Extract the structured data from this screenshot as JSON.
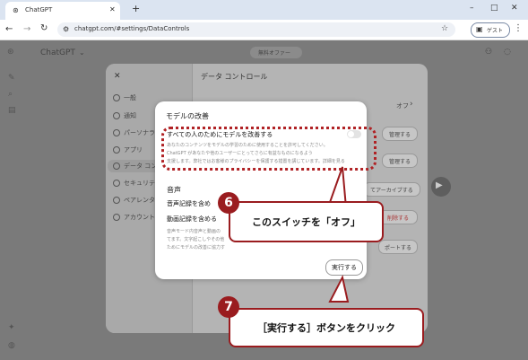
{
  "browser": {
    "tab_title": "ChatGPT",
    "url": "chatgpt.com/#settings/DataControls",
    "guest_label": "ゲスト"
  },
  "app": {
    "title": "ChatGPT",
    "top_badge": "無料オファー"
  },
  "settings": {
    "header": "データ コントロール",
    "sidebar": [
      {
        "label": "一般"
      },
      {
        "label": "通知"
      },
      {
        "label": "パーソナライズ"
      },
      {
        "label": "アプリ"
      },
      {
        "label": "データ コントロール"
      },
      {
        "label": "セキュリティ"
      },
      {
        "label": "ペアレンタル"
      },
      {
        "label": "アカウント"
      }
    ],
    "bg_value_off": "オフ",
    "bg_buttons": [
      "管理する",
      "管理する",
      "てアーカイブする",
      "削除する",
      "ポートする"
    ]
  },
  "dialog": {
    "title": "モデルの改善",
    "toggle_label": "すべての人のためにモデルを改善する",
    "toggle_desc1": "あなたのコンテンツをモデルの学習のために使用することを許可してください。",
    "toggle_desc2": "ChatGPT があなたや他のユーザーにとってさらに有益なものになるよう",
    "toggle_desc3": "支援します。弊社ではお客様のプライバシーを保護する措置を講じています。詳細を見る",
    "section_voice": "音声",
    "voice_record": "音声記録を含め",
    "video_record": "動画記録を含める",
    "voice_desc1": "音声モード内音声と動画の",
    "voice_desc2": "てます。文字起こしやその他",
    "voice_desc3": "ためにモデルの改善に協力す",
    "run_button": "実行する"
  },
  "annotations": {
    "step6_num": "6",
    "step6_text": "このスイッチを「オフ」",
    "step7_num": "7",
    "step7_text": "［実行する］ボタンをクリック"
  },
  "colors": {
    "accent": "#9a1c1f"
  }
}
